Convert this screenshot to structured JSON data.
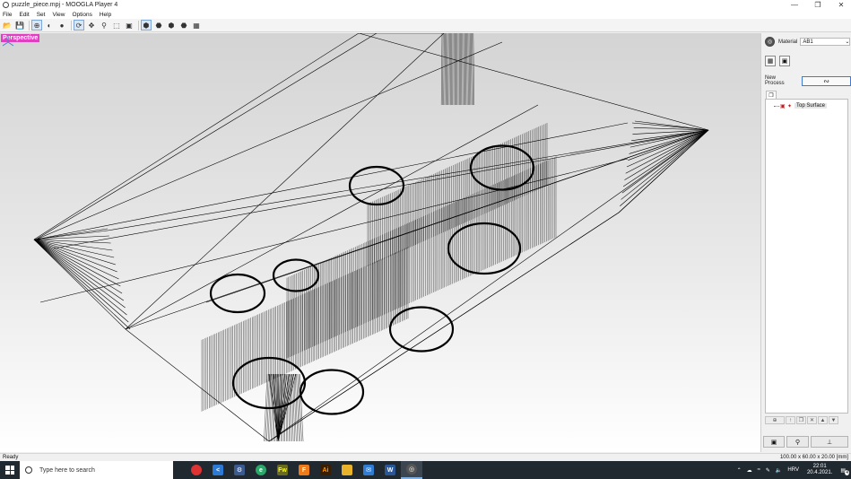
{
  "window": {
    "title": "puzzle_piece.mpj - MOOGLA Player 4",
    "minimize_glyph": "—",
    "restore_glyph": "❐",
    "close_glyph": "✕"
  },
  "menu": [
    "File",
    "Edit",
    "Set",
    "View",
    "Options",
    "Help"
  ],
  "toolbar": {
    "icons": [
      "open-icon",
      "save-icon",
      "target-icon",
      "sphere-icon",
      "sphere-dark-icon",
      "rotate-icon",
      "pan-icon",
      "zoom-icon",
      "zoom-fit-icon",
      "zoom-box-icon",
      "cube-solid-icon",
      "cube-front-icon",
      "cube-side-icon",
      "cube-iso-icon",
      "grid-icon"
    ]
  },
  "viewport": {
    "view_label": "Perspective",
    "colors": {
      "wire": "#000000",
      "label_bg": "#e040c0"
    }
  },
  "right_panel": {
    "material_label": "Material",
    "material_value": "AB1",
    "new_process_label": "New Process",
    "tree_items": [
      {
        "label": "Top Surface"
      }
    ]
  },
  "status": {
    "left": "Ready",
    "right": "100.00 x 60.00 x 20.00 [mm]"
  },
  "taskbar": {
    "search_placeholder": "Type here to search",
    "language": "HRV",
    "time": "22:01",
    "date": "20.4.2021.",
    "notification_count": "4"
  }
}
